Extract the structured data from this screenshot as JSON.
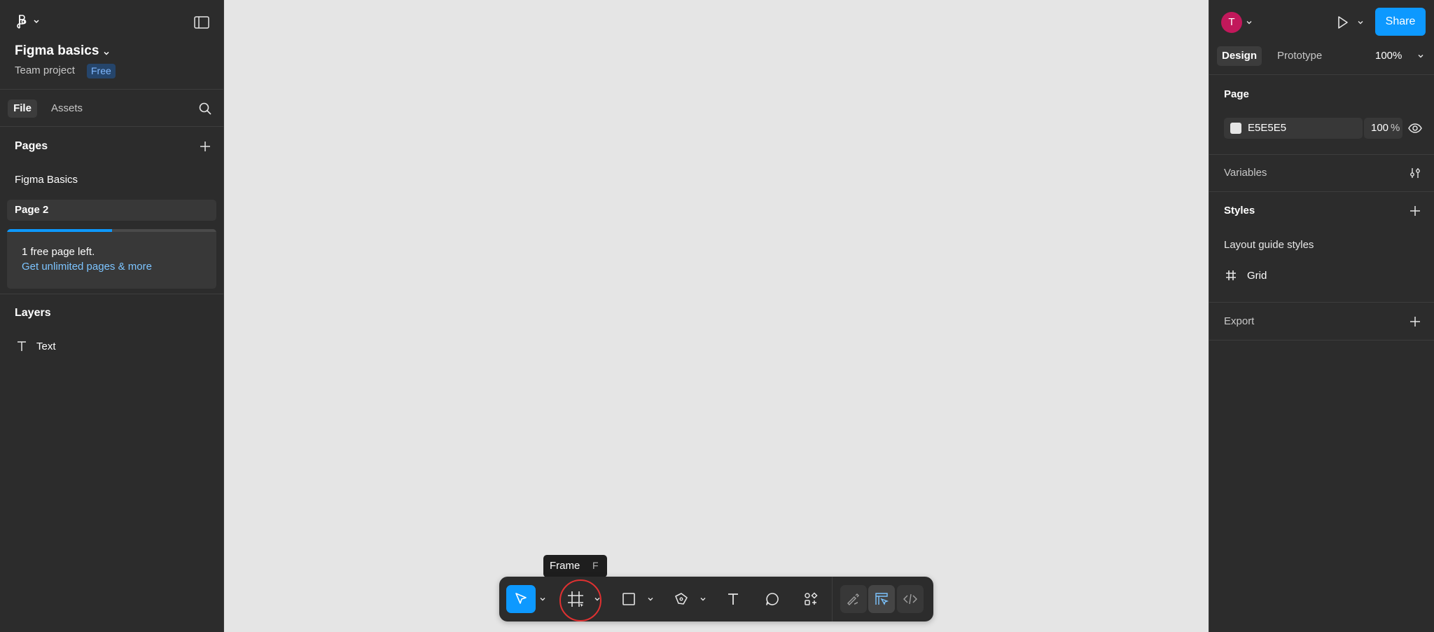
{
  "file": {
    "title": "Figma basics",
    "team": "Team project",
    "plan_badge": "Free"
  },
  "left_tabs": [
    "File",
    "Assets"
  ],
  "pages": {
    "heading": "Pages",
    "items": [
      {
        "label": "Figma Basics",
        "selected": false
      },
      {
        "label": "Page 2",
        "selected": true
      }
    ],
    "upsell_text": "1 free page left.",
    "upsell_link": "Get unlimited pages & more",
    "usage_fraction": 0.5
  },
  "layers": {
    "heading": "Layers",
    "items": [
      {
        "label": "Text",
        "icon": "text-icon"
      }
    ]
  },
  "header": {
    "avatar_initial": "T",
    "avatar_color": "#c2185b",
    "share_label": "Share"
  },
  "right_tabs": {
    "design": "Design",
    "prototype": "Prototype",
    "zoom": "100%"
  },
  "page_panel": {
    "heading": "Page",
    "bg_hex": "E5E5E5",
    "bg_opacity": "100",
    "percent": "%"
  },
  "variables": {
    "heading": "Variables"
  },
  "styles": {
    "heading": "Styles",
    "group": "Layout guide styles",
    "items": [
      {
        "label": "Grid",
        "icon": "grid-icon"
      }
    ]
  },
  "export": {
    "heading": "Export"
  },
  "tooltip": {
    "label": "Frame",
    "shortcut": "F"
  },
  "help": "?",
  "colors": {
    "accent": "#0d99ff",
    "panel": "#2c2c2c",
    "canvas": "#e5e5e5",
    "highlight_ring": "#e03131"
  },
  "toolbar": {
    "tools": [
      "move-tool",
      "frame-tool",
      "shape-tool",
      "pen-tool",
      "text-tool",
      "comment-tool",
      "actions-tool",
      "draw-mode",
      "design-mode",
      "dev-mode"
    ],
    "active": "move-tool",
    "hovered": "frame-tool"
  }
}
